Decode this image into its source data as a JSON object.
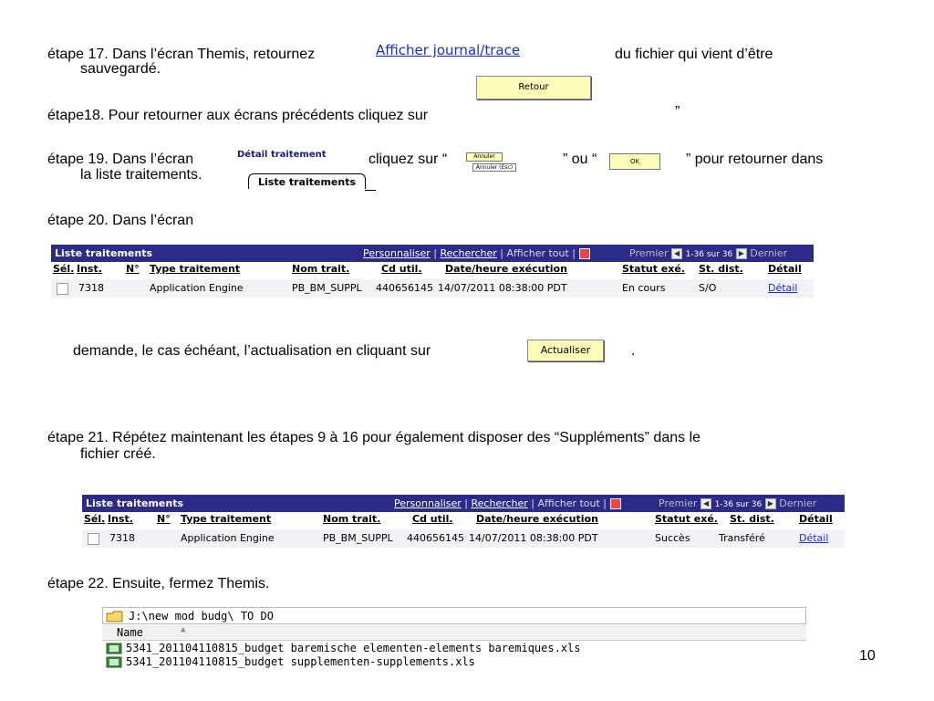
{
  "steps": {
    "s17_pre": "étape 17. Dans l’écran Themis, retournez",
    "s17_link": "Afficher journal/trace",
    "s17_post": "du fichier qui vient d’être",
    "s17_cont": "sauvegardé.",
    "s17_button": "Retour",
    "s18_text": "étape18. Pour retourner aux écrans précédents cliquez sur",
    "s18_quote": "”",
    "s19_pre": "étape 19. Dans l’écran",
    "s19_tabtitle": "Détail traitement",
    "s19_tab": "Liste traitements",
    "s19_mid": "cliquez sur “",
    "s19_annuler": "Annuler",
    "s19_annuler_esc": "Annuler (Esc)",
    "s19_or": "” ou “",
    "s19_ok": "OK",
    "s19_post": "” pour retourner dans",
    "s19_cont": "la liste traitements.",
    "s20_text": "étape 20. Dans l’écran",
    "s20_cont": "demande, le cas échéant, l’actualisation en cliquant sur",
    "s20_button": "Actualiser",
    "s20_dot": ".",
    "s21_text": "étape 21. Répétez maintenant les étapes 9 à 16 pour également disposer des “Suppléments” dans le",
    "s21_cont": "fichier créé.",
    "s22_text": "étape 22. Ensuite, fermez Themis."
  },
  "grid_common": {
    "title": "Liste traitements",
    "personnaliser": "Personnaliser",
    "rechercher": "Rechercher",
    "afficher_tout": "Afficher tout",
    "premier": "Premier",
    "range": "1-36 sur 36",
    "dernier": "Dernier",
    "columns": [
      "Sél.",
      "Inst.",
      "N°",
      "Type traitement",
      "Nom trait.",
      "Cd util.",
      "Date/heure exécution",
      "Statut exé.",
      "St. dist.",
      "Détail"
    ]
  },
  "grid1_row": {
    "inst": "7318",
    "type": "Application Engine",
    "nom": "PB_BM_SUPPL",
    "cd": "440656145",
    "date": "14/07/2011 08:38:00 PDT",
    "statut": "En cours",
    "dist": "S/O",
    "detail": "Détail"
  },
  "grid2_row": {
    "inst": "7318",
    "type": "Application Engine",
    "nom": "PB_BM_SUPPL",
    "cd": "440656145",
    "date": "14/07/2011 08:38:00 PDT",
    "statut": "Succès",
    "dist": "Transféré",
    "detail": "Détail"
  },
  "explorer": {
    "path": "J:\\new mod budg\\ TO DO",
    "name_header": "Name",
    "files": [
      "5341_201104110815_budget baremische elementen-elements baremiques.xls",
      "5341_201104110815_budget supplementen-supplements.xls"
    ]
  },
  "page_number": "10",
  "colors": {
    "grid_header": "#2b2b8a",
    "link": "#1a2fd0",
    "button": "#fdfcb8"
  }
}
